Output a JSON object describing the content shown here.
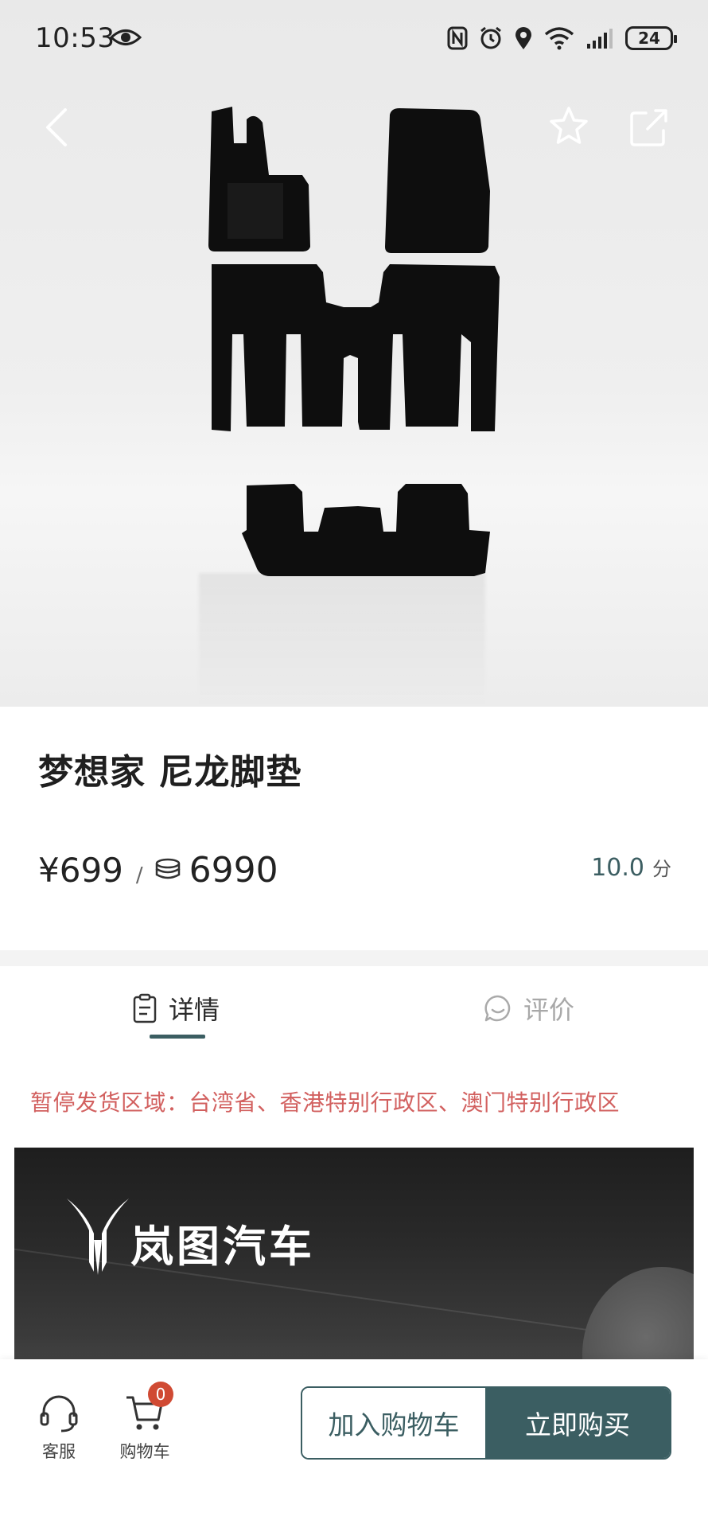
{
  "status_bar": {
    "time": "10:53",
    "battery": "24"
  },
  "product": {
    "title": "梦想家 尼龙脚垫",
    "price": "¥699",
    "separator": "/",
    "points": "6990",
    "rating": "10.0",
    "rating_unit": "分"
  },
  "tabs": [
    {
      "label": "详情",
      "icon": "clipboard-icon",
      "active": true
    },
    {
      "label": "评价",
      "icon": "chat-bubble-icon",
      "active": false
    }
  ],
  "notice": "暂停发货区域：台湾省、香港特别行政区、澳门特别行政区",
  "banner": {
    "brand": "岚图汽车"
  },
  "bottom_bar": {
    "service_label": "客服",
    "cart_label": "购物车",
    "cart_count": "0",
    "add_to_cart": "加入购物车",
    "buy_now": "立即购买"
  },
  "colors": {
    "accent": "#3b5e62",
    "notice": "#d2605f",
    "badge": "#d04a33"
  }
}
